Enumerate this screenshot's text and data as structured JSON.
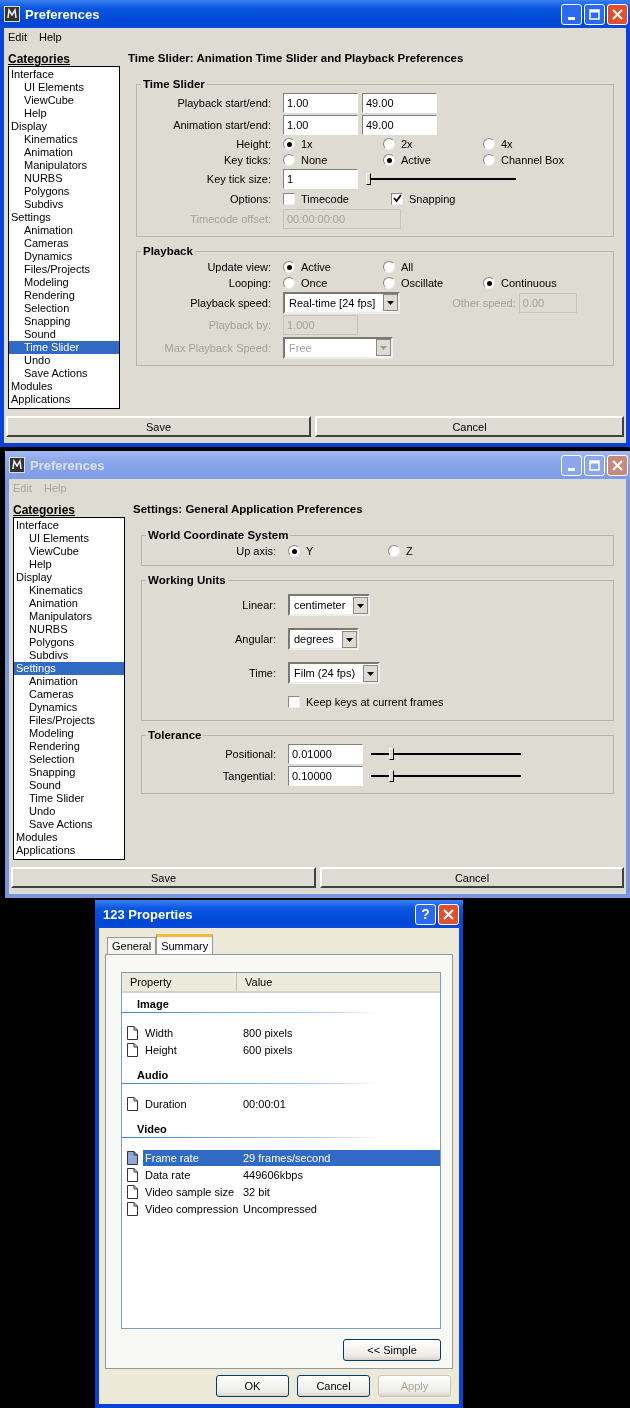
{
  "windows": [
    {
      "title": "Preferences",
      "active": true,
      "menu": [
        "Edit",
        "Help"
      ],
      "categories_label": "Categories",
      "categories": [
        {
          "label": "Interface",
          "selected": false,
          "children": [
            {
              "label": "UI Elements",
              "selected": false
            },
            {
              "label": "ViewCube",
              "selected": false
            },
            {
              "label": "Help",
              "selected": false
            }
          ]
        },
        {
          "label": "Display",
          "selected": false,
          "children": [
            {
              "label": "Kinematics",
              "selected": false
            },
            {
              "label": "Animation",
              "selected": false
            },
            {
              "label": "Manipulators",
              "selected": false
            },
            {
              "label": "NURBS",
              "selected": false
            },
            {
              "label": "Polygons",
              "selected": false
            },
            {
              "label": "Subdivs",
              "selected": false
            }
          ]
        },
        {
          "label": "Settings",
          "selected": false,
          "children": [
            {
              "label": "Animation",
              "selected": false
            },
            {
              "label": "Cameras",
              "selected": false
            },
            {
              "label": "Dynamics",
              "selected": false
            },
            {
              "label": "Files/Projects",
              "selected": false
            },
            {
              "label": "Modeling",
              "selected": false
            },
            {
              "label": "Rendering",
              "selected": false
            },
            {
              "label": "Selection",
              "selected": false
            },
            {
              "label": "Snapping",
              "selected": false
            },
            {
              "label": "Sound",
              "selected": false
            },
            {
              "label": "Time Slider",
              "selected": true
            },
            {
              "label": "Undo",
              "selected": false
            },
            {
              "label": "Save Actions",
              "selected": false
            }
          ]
        },
        {
          "label": "Modules",
          "selected": false
        },
        {
          "label": "Applications",
          "selected": false
        }
      ],
      "heading": "Time Slider: Animation Time Slider and Playback Preferences",
      "groups": [
        {
          "title": "Time Slider",
          "rows": [
            {
              "kind": "fields",
              "label": "Playback start/end:",
              "values": [
                "1.00",
                "49.00"
              ],
              "disabled": false
            },
            {
              "kind": "fields",
              "label": "Animation start/end:",
              "values": [
                "1.00",
                "49.00"
              ],
              "disabled": false
            },
            {
              "kind": "radios",
              "label": "Height:",
              "options": [
                {
                  "label": "1x",
                  "selected": true
                },
                {
                  "label": "2x",
                  "selected": false
                },
                {
                  "label": "4x",
                  "selected": false
                }
              ]
            },
            {
              "kind": "radios",
              "label": "Key ticks:",
              "options": [
                {
                  "label": "None",
                  "selected": false
                },
                {
                  "label": "Active",
                  "selected": true
                },
                {
                  "label": "Channel Box",
                  "selected": false
                }
              ]
            },
            {
              "kind": "slider",
              "label": "Key tick size:",
              "value": "1",
              "level": 0.0
            },
            {
              "kind": "checks",
              "label": "Options:",
              "options": [
                {
                  "label": "Timecode",
                  "checked": false
                },
                {
                  "label": "Snapping",
                  "checked": true
                }
              ]
            },
            {
              "kind": "fields",
              "label": "Timecode offset:",
              "values": [
                "00:00:00:00"
              ],
              "disabled": true
            }
          ]
        },
        {
          "title": "Playback",
          "rows": [
            {
              "kind": "radios",
              "label": "Update view:",
              "options": [
                {
                  "label": "Active",
                  "selected": true
                },
                {
                  "label": "All",
                  "selected": false
                }
              ]
            },
            {
              "kind": "radios",
              "label": "Looping:",
              "options": [
                {
                  "label": "Once",
                  "selected": false
                },
                {
                  "label": "Oscillate",
                  "selected": false
                },
                {
                  "label": "Continuous",
                  "selected": true
                }
              ]
            },
            {
              "kind": "dropdown",
              "label": "Playback speed:",
              "value": "Real-time [24 fps]",
              "disabled": false,
              "side": {
                "label": "Other speed:",
                "value": "0.00",
                "disabled": true
              }
            },
            {
              "kind": "fields",
              "label": "Playback by:",
              "values": [
                "1.000"
              ],
              "disabled": true
            },
            {
              "kind": "dropdown",
              "label": "Max Playback Speed:",
              "value": "Free",
              "disabled": true
            }
          ]
        }
      ],
      "buttons": [
        "Save",
        "Cancel"
      ]
    },
    {
      "title": "Preferences",
      "active": false,
      "menu": [
        "Edit",
        "Help"
      ],
      "categories_label": "Categories",
      "categories": [
        {
          "label": "Interface",
          "selected": false,
          "children": [
            {
              "label": "UI Elements",
              "selected": false
            },
            {
              "label": "ViewCube",
              "selected": false
            },
            {
              "label": "Help",
              "selected": false
            }
          ]
        },
        {
          "label": "Display",
          "selected": false,
          "children": [
            {
              "label": "Kinematics",
              "selected": false
            },
            {
              "label": "Animation",
              "selected": false
            },
            {
              "label": "Manipulators",
              "selected": false
            },
            {
              "label": "NURBS",
              "selected": false
            },
            {
              "label": "Polygons",
              "selected": false
            },
            {
              "label": "Subdivs",
              "selected": false
            }
          ]
        },
        {
          "label": "Settings",
          "selected": true,
          "children": [
            {
              "label": "Animation",
              "selected": false
            },
            {
              "label": "Cameras",
              "selected": false
            },
            {
              "label": "Dynamics",
              "selected": false
            },
            {
              "label": "Files/Projects",
              "selected": false
            },
            {
              "label": "Modeling",
              "selected": false
            },
            {
              "label": "Rendering",
              "selected": false
            },
            {
              "label": "Selection",
              "selected": false
            },
            {
              "label": "Snapping",
              "selected": false
            },
            {
              "label": "Sound",
              "selected": false
            },
            {
              "label": "Time Slider",
              "selected": false
            },
            {
              "label": "Undo",
              "selected": false
            },
            {
              "label": "Save Actions",
              "selected": false
            }
          ]
        },
        {
          "label": "Modules",
          "selected": false
        },
        {
          "label": "Applications",
          "selected": false
        }
      ],
      "heading": "Settings: General Application Preferences",
      "groups": [
        {
          "title": "World Coordinate System",
          "rows": [
            {
              "kind": "radios",
              "label": "Up axis:",
              "options": [
                {
                  "label": "Y",
                  "selected": true
                },
                {
                  "label": "Z",
                  "selected": false
                }
              ]
            }
          ]
        },
        {
          "title": "Working Units",
          "rows": [
            {
              "kind": "dropdown",
              "label": "Linear:",
              "value": "centimeter",
              "disabled": false
            },
            {
              "kind": "dropdown",
              "label": "Angular:",
              "value": "degrees",
              "disabled": false
            },
            {
              "kind": "dropdown",
              "label": "Time:",
              "value": "Film (24 fps)",
              "disabled": false
            },
            {
              "kind": "checks",
              "options": [
                {
                  "label": "Keep keys at current frames",
                  "checked": false
                }
              ]
            }
          ]
        },
        {
          "title": "Tolerance",
          "rows": [
            {
              "kind": "slider",
              "label": "Positional:",
              "value": "0.01000",
              "level": 0.12
            },
            {
              "kind": "slider",
              "label": "Tangential:",
              "value": "0.10000",
              "level": 0.12
            }
          ]
        }
      ],
      "buttons": [
        "Save",
        "Cancel"
      ]
    }
  ],
  "properties": {
    "title": "123 Properties",
    "help_button": "?",
    "tabs": [
      {
        "label": "General",
        "selected": false
      },
      {
        "label": "Summary",
        "selected": true
      }
    ],
    "columns": [
      "Property",
      "Value"
    ],
    "sections": [
      {
        "title": "Image",
        "rows": [
          {
            "property": "Width",
            "value": "800 pixels",
            "selected": false
          },
          {
            "property": "Height",
            "value": "600 pixels",
            "selected": false
          }
        ]
      },
      {
        "title": "Audio",
        "rows": [
          {
            "property": "Duration",
            "value": "00:00:01",
            "selected": false
          }
        ]
      },
      {
        "title": "Video",
        "rows": [
          {
            "property": "Frame rate",
            "value": "29 frames/second",
            "selected": true
          },
          {
            "property": "Data rate",
            "value": "449606kbps",
            "selected": false
          },
          {
            "property": "Video sample size",
            "value": "32 bit",
            "selected": false
          },
          {
            "property": "Video compression",
            "value": "Uncompressed",
            "selected": false
          }
        ]
      }
    ],
    "toggle_button": "<< Simple",
    "buttons": [
      {
        "label": "OK",
        "disabled": false
      },
      {
        "label": "Cancel",
        "disabled": false
      },
      {
        "label": "Apply",
        "disabled": true
      }
    ]
  }
}
